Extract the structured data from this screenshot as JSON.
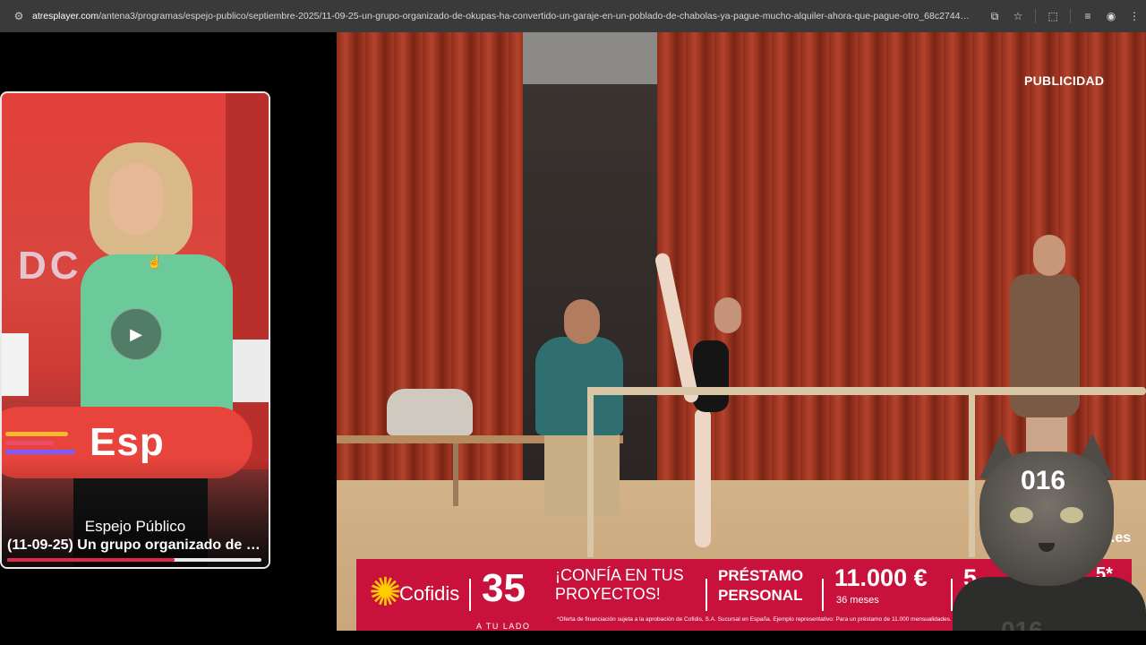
{
  "browser": {
    "url_host": "atresplayer.com",
    "url_path": "/antena3/programas/espejo-publico/septiembre-2025/11-09-25-un-grupo-organizado-de-okupas-ha-convertido-un-garaje-en-un-poblado-de-chabolas-ya-pague-mucho-alquiler-ahora-que-pague-otro_68c2744dd32ea30007..."
  },
  "mini_player": {
    "brand_text": "Esp",
    "show_title": "Espejo Público",
    "episode_title": "(11-09-25) Un grupo organizado de o...",
    "progress": 0.66,
    "stripe_colors": [
      "#f7b733",
      "#e94b6a",
      "#7b5cff"
    ]
  },
  "ad": {
    "label": "PUBLICIDAD",
    "site_peek": "s.es",
    "banner": {
      "brand": "Cofidis",
      "anniversary_number": "35",
      "anniversary_sub": "A TU LADO",
      "slogan": "¡CONFÍA EN TUS PROYECTOS!",
      "product": "PRÉSTAMO PERSONAL",
      "amount": "11.000 €",
      "months": "36 meses",
      "second_value_start": "5",
      "second_value_end": "5*",
      "fine_print": "*Oferta de financiación sujeta a la aprobación de Cofidis, S.A. Sucursal en España. Ejemplo representativo: Para un préstamo de 11.000 mensualidades. 35 por importe de 331,91 € al mes y una última mensualidad de 331,80 €. Coste total del préstamo (importe total d"
    }
  },
  "overlay": {
    "cat_number": "016",
    "armor_number": "016"
  },
  "colors": {
    "banner_red": "#c8123c",
    "progress_red": "#e4264a"
  }
}
